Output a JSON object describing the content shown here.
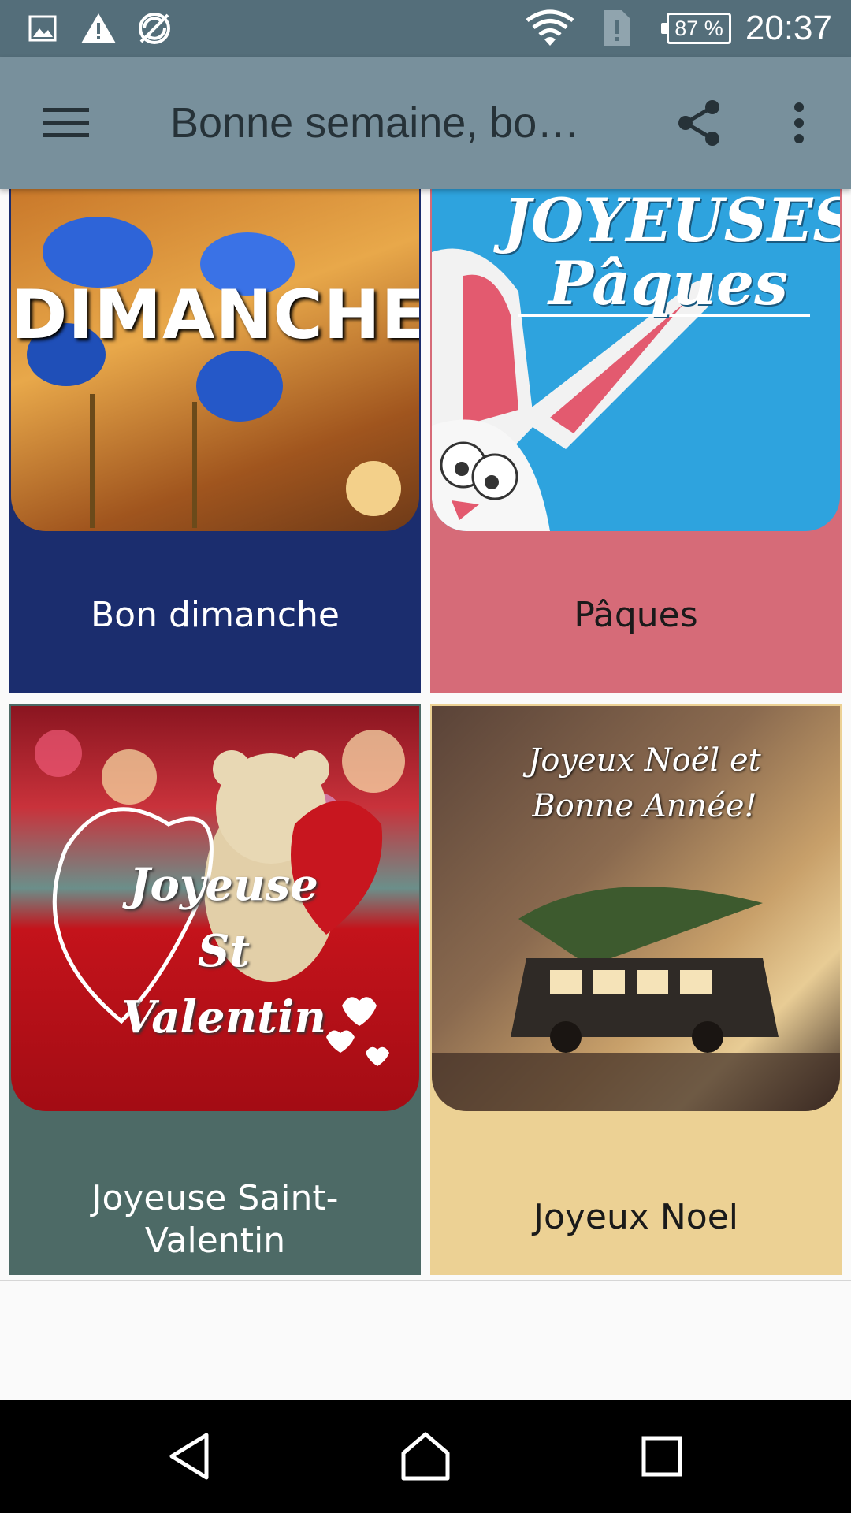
{
  "status_bar": {
    "time": "20:37",
    "battery": "87 %",
    "icons": [
      "image-icon",
      "warning-icon",
      "no-sync-icon",
      "wifi-icon",
      "sim-alert-icon",
      "battery-icon"
    ]
  },
  "app_bar": {
    "title": "Bonne semaine, bo…",
    "menu_icon": "hamburger-menu-icon",
    "share_icon": "share-icon",
    "more_icon": "more-vert-icon",
    "color": "#78909c"
  },
  "cards": [
    {
      "label": "Bon dimanche",
      "image_text": "DIMANCHE",
      "bg": "#1b2d6e",
      "text_color": "#ffffff"
    },
    {
      "label": "Pâques",
      "image_text": "JOYEUSES Pâques",
      "bg": "#d66b78",
      "text_color": "#1a1a1a"
    },
    {
      "label": "Joyeuse Saint-Valentin",
      "image_text": "Joyeuse St Valentin",
      "bg": "#4d6a66",
      "text_color": "#ffffff"
    },
    {
      "label": "Joyeux Noel",
      "image_text": "Joyeux Noël et Bonne Année!",
      "bg": "#ecd194",
      "text_color": "#1a1a1a"
    }
  ],
  "nav_bar": {
    "back_icon": "back-icon",
    "home_icon": "home-icon",
    "recents_icon": "recents-icon"
  }
}
